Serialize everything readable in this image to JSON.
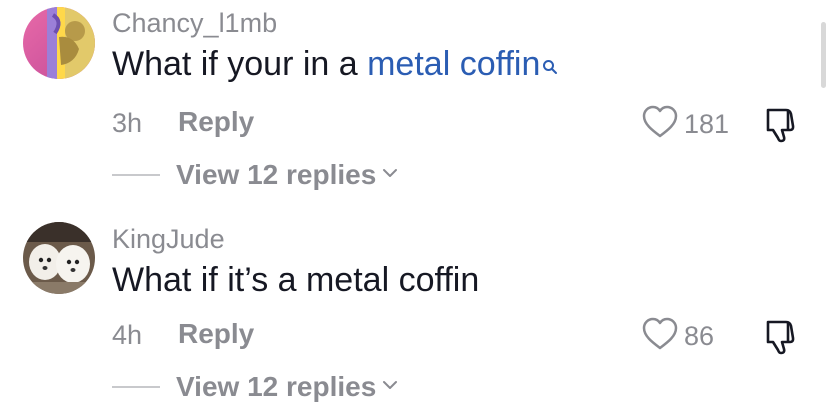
{
  "comments": [
    {
      "username": "Chancy_l1mb",
      "text_prefix": "What if your in a ",
      "search_link_text": "metal coffin",
      "time": "3h",
      "reply_label": "Reply",
      "likes": "181",
      "view_replies_label": "View 12 replies",
      "avatar_icon": "avatar-image"
    },
    {
      "username": "KingJude",
      "text": "What if it’s a metal coffin",
      "time": "4h",
      "reply_label": "Reply",
      "likes": "86",
      "view_replies_label": "View 12 replies",
      "avatar_icon": "avatar-image"
    }
  ],
  "colors": {
    "text": "#161823",
    "secondary": "#8a8b91",
    "link": "#2b5db3",
    "divider": "#c8c9cc"
  },
  "icons": {
    "like": "heart-outline-icon",
    "dislike": "thumbs-down-icon",
    "chevron": "chevron-down-icon",
    "search": "search-icon"
  }
}
